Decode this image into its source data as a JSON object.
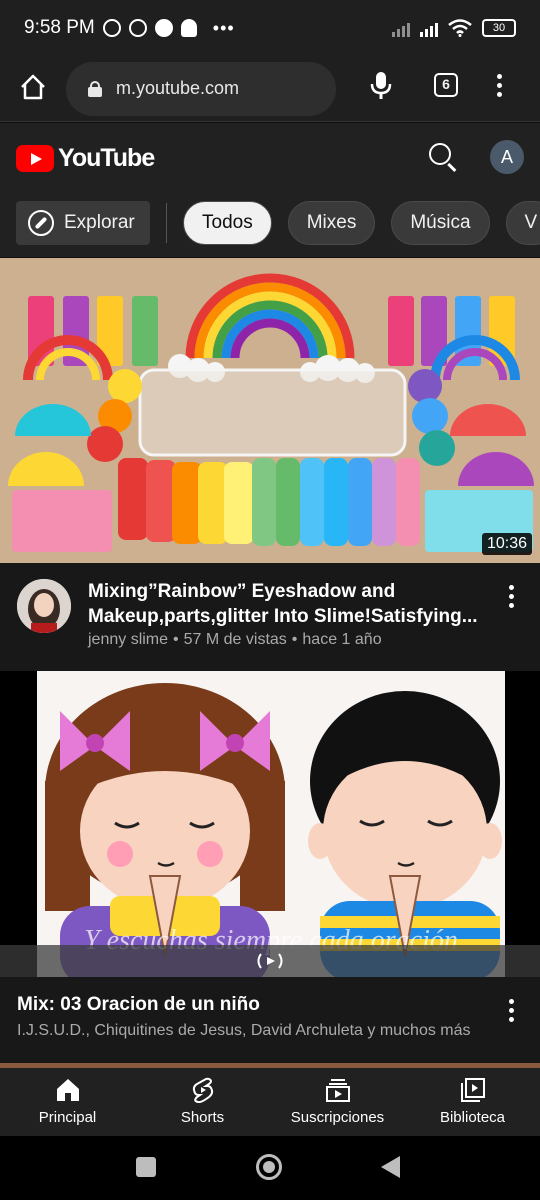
{
  "status_bar": {
    "time": "9:58 PM",
    "battery": "30"
  },
  "browser": {
    "url": "m.youtube.com",
    "tab_count": "6"
  },
  "header": {
    "logo_text": "YouTube",
    "account_initial": "A"
  },
  "chips": {
    "explore": "Explorar",
    "items": [
      "Todos",
      "Mixes",
      "Música",
      "V"
    ],
    "active": "Todos"
  },
  "videos": [
    {
      "title": "Mixing”Rainbow” Eyeshadow and Makeup,parts,glitter Into Slime!Satisfying...",
      "channel": "jenny slime",
      "views": "57 M de vistas",
      "age": "hace 1 año",
      "duration": "10:36"
    }
  ],
  "mix": {
    "title": "Mix: 03 Oracion de un niño",
    "subtitle": "I.J.S.U.D., Chiquitines de Jesus, David Archuleta y muchos más",
    "caption": "Y escuchas siempre cada oración"
  },
  "bottom_nav": [
    {
      "label": "Principal",
      "icon": "home-icon"
    },
    {
      "label": "Shorts",
      "icon": "shorts-icon"
    },
    {
      "label": "Suscripciones",
      "icon": "subscriptions-icon"
    },
    {
      "label": "Biblioteca",
      "icon": "library-icon"
    }
  ],
  "colors": {
    "brand_red": "#ff0000",
    "background": "#0f0f0f",
    "chip_active": "#f1f1f1"
  }
}
